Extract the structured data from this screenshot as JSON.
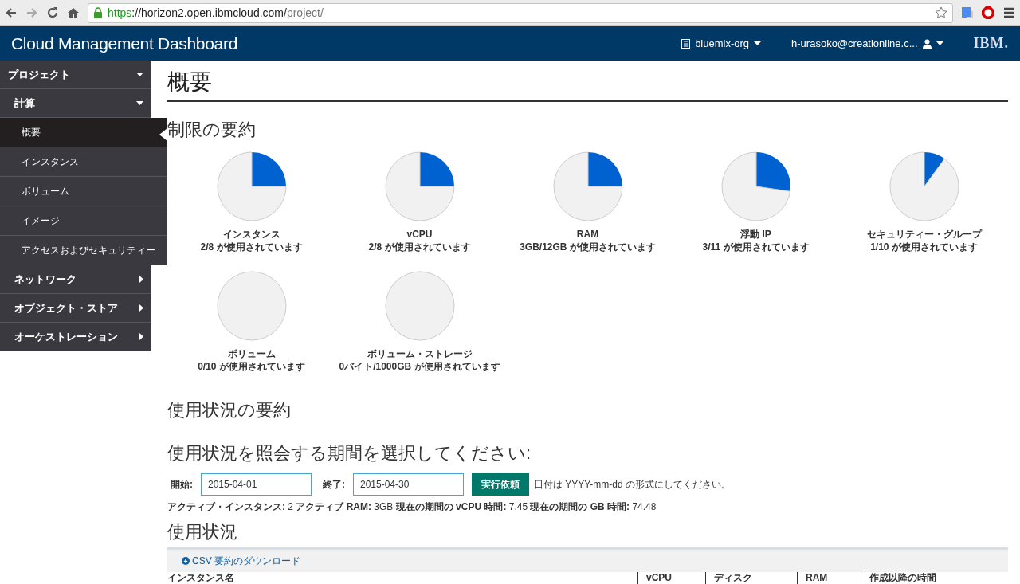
{
  "browser": {
    "url_scheme": "https",
    "url_host": "://horizon2.open.ibmcloud.com/",
    "url_path": "project/"
  },
  "header": {
    "title": "Cloud Management Dashboard",
    "org": "bluemix-org",
    "user": "h-urasoko@creationline.c...",
    "logo": "IBM."
  },
  "sidebar": {
    "items": [
      {
        "label": "プロジェクト",
        "expanded": true,
        "children": [
          {
            "label": "計算",
            "expanded": true,
            "children": [
              {
                "label": "概要",
                "selected": true
              },
              {
                "label": "インスタンス",
                "selected": false
              },
              {
                "label": "ボリューム",
                "selected": false
              },
              {
                "label": "イメージ",
                "selected": false
              },
              {
                "label": "アクセスおよびセキュリティー",
                "selected": false
              }
            ]
          },
          {
            "label": "ネットワーク",
            "expanded": false
          },
          {
            "label": "オブジェクト・ストア",
            "expanded": false
          },
          {
            "label": "オーケストレーション",
            "expanded": false
          }
        ]
      }
    ]
  },
  "page_title": "概要",
  "limits": {
    "title": "制限の要約",
    "quotas": [
      {
        "name": "インスタンス",
        "usage": "2/8 が使用されています",
        "chart_data": {
          "type": "pie",
          "values": [
            25,
            75
          ]
        }
      },
      {
        "name": "vCPU",
        "usage": "2/8 が使用されています",
        "chart_data": {
          "type": "pie",
          "values": [
            25,
            75
          ]
        }
      },
      {
        "name": "RAM",
        "usage": "3GB/12GB が使用されています",
        "chart_data": {
          "type": "pie",
          "values": [
            25,
            75
          ]
        }
      },
      {
        "name": "浮動 IP",
        "usage": "3/11 が使用されています",
        "chart_data": {
          "type": "pie",
          "values": [
            27.3,
            72.7
          ]
        }
      },
      {
        "name": "セキュリティー・グループ",
        "usage": "1/10 が使用されています",
        "chart_data": {
          "type": "pie",
          "values": [
            10,
            90
          ]
        }
      },
      {
        "name": "ボリューム",
        "usage": "0/10 が使用されています",
        "chart_data": {
          "type": "pie",
          "values": [
            0,
            100
          ]
        }
      },
      {
        "name": "ボリューム・ストレージ",
        "usage": "0バイト/1000GB が使用されています",
        "chart_data": {
          "type": "pie",
          "values": [
            0,
            100
          ]
        }
      }
    ]
  },
  "usage_summary": {
    "title": "使用状況の要約",
    "period_title": "使用状況を照会する期間を選択してください:",
    "start_label": "開始:",
    "start_value": "2015-04-01",
    "end_label": "終了:",
    "end_value": "2015-04-30",
    "submit": "実行依頼",
    "hint": "日付は YYYY-mm-dd の形式にしてください。",
    "stats": "**アクティブ・インスタンス:** 2 **アクティブ RAM:** 3GB **現在の期間の vCPU 時間:** 7.45 **現在の期間の GB 時間:** 74.48"
  },
  "usage": {
    "title": "使用状況",
    "download": "CSV 要約のダウンロード",
    "columns": [
      "インスタンス名",
      "vCPU",
      "ディスク",
      "RAM",
      "作成以降の時間"
    ]
  }
}
